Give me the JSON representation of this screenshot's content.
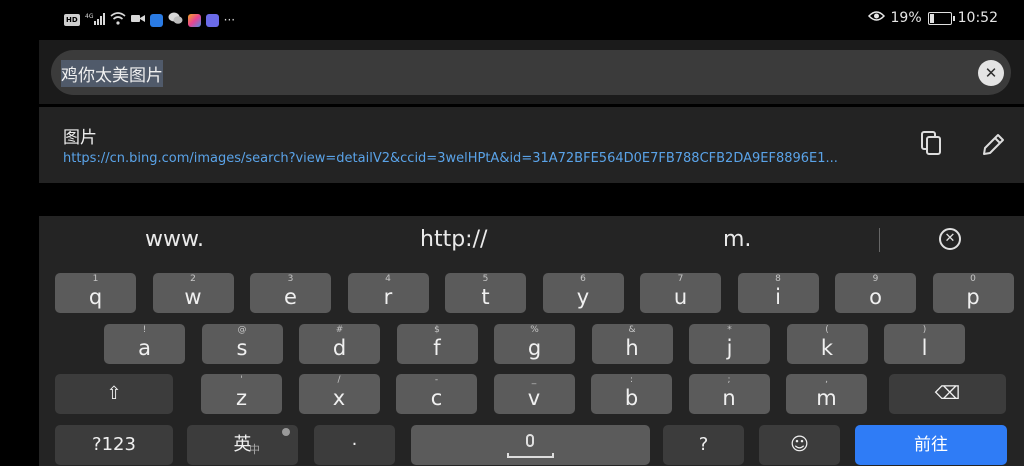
{
  "status_bar": {
    "signal_text": "4G",
    "battery_percent": "19%",
    "battery_level": 0.19,
    "time": "10:52",
    "more_dots": "···"
  },
  "url_bar": {
    "query": "鸡你太美图片",
    "clear_icon": "close-icon"
  },
  "suggestion": {
    "title": "图片",
    "url": "https://cn.bing.com/images/search?view=detailV2&ccid=3welHPtA&id=31A72BFE564D0E7FB788CFB2DA9EF8896E1..."
  },
  "keyboard": {
    "quick": [
      "www.",
      "http://",
      "m."
    ],
    "row1": [
      {
        "sub": "1",
        "main": "q"
      },
      {
        "sub": "2",
        "main": "w"
      },
      {
        "sub": "3",
        "main": "e"
      },
      {
        "sub": "4",
        "main": "r"
      },
      {
        "sub": "5",
        "main": "t"
      },
      {
        "sub": "6",
        "main": "y"
      },
      {
        "sub": "7",
        "main": "u"
      },
      {
        "sub": "8",
        "main": "i"
      },
      {
        "sub": "9",
        "main": "o"
      },
      {
        "sub": "0",
        "main": "p"
      }
    ],
    "row2": [
      {
        "sub": "!",
        "main": "a"
      },
      {
        "sub": "@",
        "main": "s"
      },
      {
        "sub": "#",
        "main": "d"
      },
      {
        "sub": "$",
        "main": "f"
      },
      {
        "sub": "%",
        "main": "g"
      },
      {
        "sub": "&",
        "main": "h"
      },
      {
        "sub": "*",
        "main": "j"
      },
      {
        "sub": "(",
        "main": "k"
      },
      {
        "sub": ")",
        "main": "l"
      }
    ],
    "row3": [
      {
        "sub": "'",
        "main": "z"
      },
      {
        "sub": "/",
        "main": "x"
      },
      {
        "sub": "-",
        "main": "c"
      },
      {
        "sub": "_",
        "main": "v"
      },
      {
        "sub": ":",
        "main": "b"
      },
      {
        "sub": ";",
        "main": "n"
      },
      {
        "sub": ",",
        "main": "m"
      }
    ],
    "shift_icon": "⇧",
    "backspace_icon": "⌫",
    "symbols_label": "?123",
    "lang_label": "英",
    "lang_sub": "中",
    "dot_label": "·",
    "question_label": "?",
    "emoji_icon": "☺",
    "go_label": "前往"
  }
}
